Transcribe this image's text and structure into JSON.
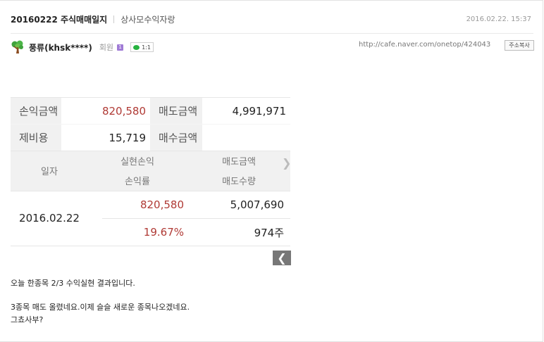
{
  "post": {
    "title": "20160222 주식매매일지",
    "board": "상사모수익자랑",
    "date": "2016.02.22. 15:37"
  },
  "author": {
    "nickname": "풍류(khsk****)",
    "grade": "회원",
    "level": "1",
    "talk_label": "1:1",
    "url": "http://cafe.naver.com/onetop/424043",
    "copy_label": "주소복사"
  },
  "summary": {
    "profit_label": "손익금액",
    "profit_value": "820,580",
    "sell_label": "매도금액",
    "sell_value": "4,991,971",
    "cost_label": "제비용",
    "cost_value": "15,719",
    "buy_label": "매수금액",
    "buy_value": ""
  },
  "detail": {
    "col_date": "일자",
    "col_realized": "실현손익",
    "col_rate": "손익률",
    "col_sell_amount": "매도금액",
    "col_sell_qty": "매도수량",
    "rows": [
      {
        "date": "2016.02.22",
        "realized": "820,580",
        "rate": "19.67%",
        "sell_amount": "5,007,690",
        "sell_qty": "974주"
      }
    ]
  },
  "content": {
    "line1": "오늘 한종목 2/3 수익실현 결과입니다.",
    "line2": "3종목 매도 올렸네요.이제 슬슬 새로운 종목나오겠네요.",
    "line3": "그쵸사부?"
  },
  "colors": {
    "profit": "#b03a35",
    "label_bg": "#f1f1f1"
  },
  "icons": [
    "tree-icon",
    "talk-icon",
    "chevron-right-icon",
    "chevron-left-icon"
  ]
}
